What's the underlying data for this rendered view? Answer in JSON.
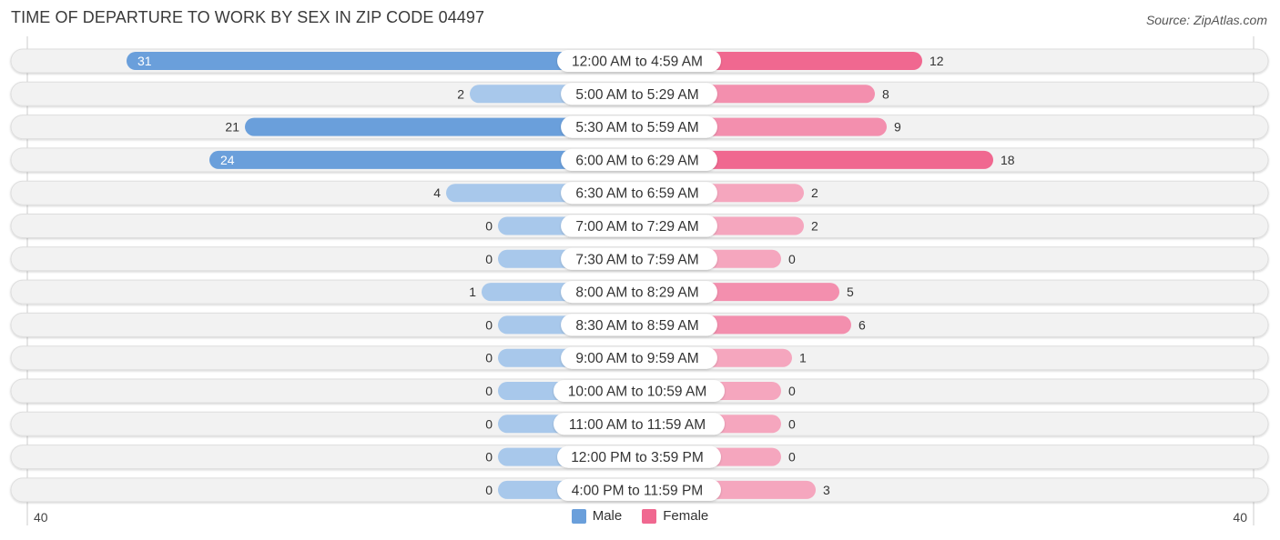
{
  "header": {
    "title": "TIME OF DEPARTURE TO WORK BY SEX IN ZIP CODE 04497",
    "source": "Source: ZipAtlas.com"
  },
  "colors": {
    "male": "#6a9fdb",
    "male_light": "#a8c8eb",
    "female": "#f06890",
    "female_light": "#f5a6be",
    "track": "#f2f2f2",
    "label_bg": "#ffffff"
  },
  "chart_data": {
    "type": "bar",
    "orientation": "horizontal-diverging",
    "title": "TIME OF DEPARTURE TO WORK BY SEX IN ZIP CODE 04497",
    "categories": [
      "12:00 AM to 4:59 AM",
      "5:00 AM to 5:29 AM",
      "5:30 AM to 5:59 AM",
      "6:00 AM to 6:29 AM",
      "6:30 AM to 6:59 AM",
      "7:00 AM to 7:29 AM",
      "7:30 AM to 7:59 AM",
      "8:00 AM to 8:29 AM",
      "8:30 AM to 8:59 AM",
      "9:00 AM to 9:59 AM",
      "10:00 AM to 10:59 AM",
      "11:00 AM to 11:59 AM",
      "12:00 PM to 3:59 PM",
      "4:00 PM to 11:59 PM"
    ],
    "series": [
      {
        "name": "Male",
        "values": [
          31,
          2,
          21,
          24,
          4,
          0,
          0,
          1,
          0,
          0,
          0,
          0,
          0,
          0
        ]
      },
      {
        "name": "Female",
        "values": [
          12,
          8,
          9,
          18,
          2,
          2,
          0,
          5,
          6,
          1,
          0,
          0,
          0,
          3
        ]
      }
    ],
    "xlim": [
      -40,
      40
    ],
    "tick_labels": {
      "left": "40",
      "right": "40"
    },
    "legend": [
      "Male",
      "Female"
    ],
    "legend_position": "bottom-center",
    "grid": false
  }
}
